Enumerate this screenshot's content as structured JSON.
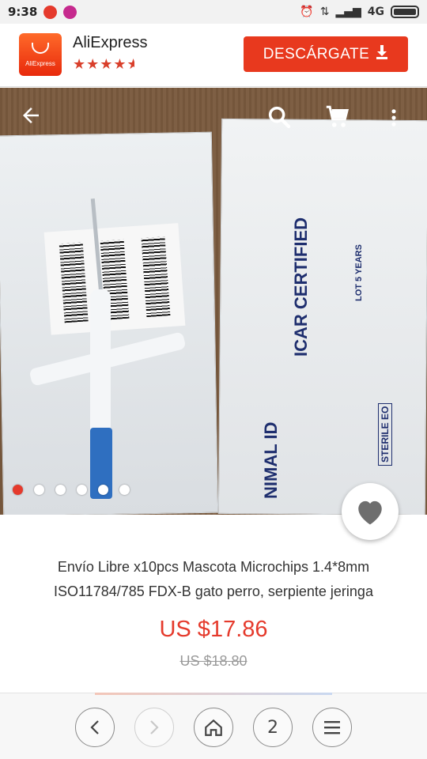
{
  "status_bar": {
    "time": "9:38",
    "network": "4G"
  },
  "app_banner": {
    "app_name": "AliExpress",
    "logo_text": "AliExpress",
    "rating_stars": "★★★★",
    "rating_value": 4.5,
    "download_label": "DESCÁRGATE",
    "download_icon": "download-icon"
  },
  "product_image": {
    "printed_text": {
      "icar": "ICAR CERTIFIED",
      "animal": "NIMAL ID",
      "lot": "LOT 5 YEARS",
      "sterile": "STERILE EO"
    },
    "carousel_dots": 6,
    "active_dot": 0
  },
  "nav": {
    "back_icon": "arrow-left-icon",
    "search_icon": "search-icon",
    "cart_icon": "cart-icon",
    "more_icon": "more-vertical-icon"
  },
  "product": {
    "title_line1": "Envío Libre x10pcs Mascota Microchips 1.4*8mm",
    "title_line2": "ISO11784/785 FDX-B gato perro, serpiente jeringa",
    "price": "US $17.86",
    "old_price": "US $18.80"
  },
  "browser_nav": {
    "tabs_count": "2"
  },
  "colors": {
    "accent": "#e53a2c",
    "button": "#e8391e"
  }
}
